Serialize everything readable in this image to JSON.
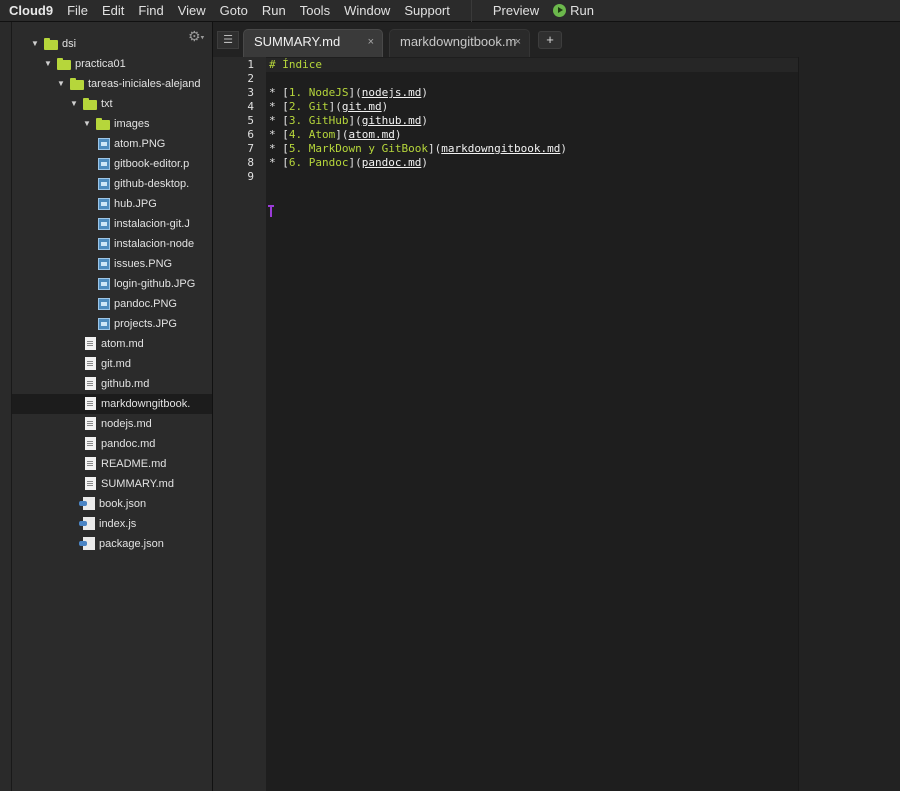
{
  "menubar": {
    "brand": "Cloud9",
    "items": [
      "File",
      "Edit",
      "Find",
      "View",
      "Goto",
      "Run",
      "Tools",
      "Window",
      "Support"
    ],
    "preview": "Preview",
    "run": "Run"
  },
  "tree": {
    "items": [
      {
        "label": "dsi",
        "type": "folder",
        "level": 0
      },
      {
        "label": "practica01",
        "type": "folder",
        "level": 1
      },
      {
        "label": "tareas-iniciales-alejand",
        "type": "folder",
        "level": 2
      },
      {
        "label": "txt",
        "type": "folder",
        "level": 3
      },
      {
        "label": "images",
        "type": "folder",
        "level": 4
      },
      {
        "label": "atom.PNG",
        "type": "image",
        "level": 5
      },
      {
        "label": "gitbook-editor.p",
        "type": "image",
        "level": 5
      },
      {
        "label": "github-desktop.",
        "type": "image",
        "level": 5
      },
      {
        "label": "hub.JPG",
        "type": "image",
        "level": 5
      },
      {
        "label": "instalacion-git.J",
        "type": "image",
        "level": 5
      },
      {
        "label": "instalacion-node",
        "type": "image",
        "level": 5
      },
      {
        "label": "issues.PNG",
        "type": "image",
        "level": 5
      },
      {
        "label": "login-github.JPG",
        "type": "image",
        "level": 5
      },
      {
        "label": "pandoc.PNG",
        "type": "image",
        "level": 5
      },
      {
        "label": "projects.JPG",
        "type": "image",
        "level": 5
      },
      {
        "label": "atom.md",
        "type": "doc",
        "level": 4
      },
      {
        "label": "git.md",
        "type": "doc",
        "level": 4
      },
      {
        "label": "github.md",
        "type": "doc",
        "level": 4
      },
      {
        "label": "markdowngitbook.",
        "type": "doc",
        "level": 4,
        "selected": true
      },
      {
        "label": "nodejs.md",
        "type": "doc",
        "level": 4
      },
      {
        "label": "pandoc.md",
        "type": "doc",
        "level": 4
      },
      {
        "label": "README.md",
        "type": "doc",
        "level": 4
      },
      {
        "label": "SUMMARY.md",
        "type": "doc",
        "level": 4
      },
      {
        "label": "book.json",
        "type": "js",
        "level": 3
      },
      {
        "label": "index.js",
        "type": "js",
        "level": 3
      },
      {
        "label": "package.json",
        "type": "js",
        "level": 3
      }
    ]
  },
  "tabs": {
    "active": "SUMMARY.md",
    "inactive": "markdowngitbook.m",
    "close": "×",
    "plus": "+"
  },
  "editor": {
    "line_numbers": [
      "1",
      "2",
      "3",
      "4",
      "5",
      "6",
      "7",
      "8",
      "9"
    ],
    "lines": [
      [
        {
          "t": "# Índice",
          "c": "head"
        }
      ],
      [],
      [
        {
          "t": "* ["
        },
        {
          "t": "1. NodeJS",
          "c": "link"
        },
        {
          "t": "]("
        },
        {
          "t": "nodejs.md",
          "c": "url"
        },
        {
          "t": ")"
        }
      ],
      [
        {
          "t": "* ["
        },
        {
          "t": "2. Git",
          "c": "link"
        },
        {
          "t": "]("
        },
        {
          "t": "git.md",
          "c": "url"
        },
        {
          "t": ")"
        }
      ],
      [
        {
          "t": "* ["
        },
        {
          "t": "3. GitHub",
          "c": "link"
        },
        {
          "t": "]("
        },
        {
          "t": "github.md",
          "c": "url"
        },
        {
          "t": ")"
        }
      ],
      [
        {
          "t": "* ["
        },
        {
          "t": "4. Atom",
          "c": "link"
        },
        {
          "t": "]("
        },
        {
          "t": "atom.md",
          "c": "url"
        },
        {
          "t": ")"
        }
      ],
      [
        {
          "t": "* ["
        },
        {
          "t": "5. MarkDown y GitBook",
          "c": "link"
        },
        {
          "t": "]("
        },
        {
          "t": "markdowngitbook.md",
          "c": "url"
        },
        {
          "t": ")"
        }
      ],
      [
        {
          "t": "* ["
        },
        {
          "t": "6. Pandoc",
          "c": "link"
        },
        {
          "t": "]("
        },
        {
          "t": "pandoc.md",
          "c": "url"
        },
        {
          "t": ")"
        }
      ],
      []
    ]
  },
  "colors": {
    "accent_green": "#b6d63b",
    "cursor_purple": "#9b3bd8"
  }
}
